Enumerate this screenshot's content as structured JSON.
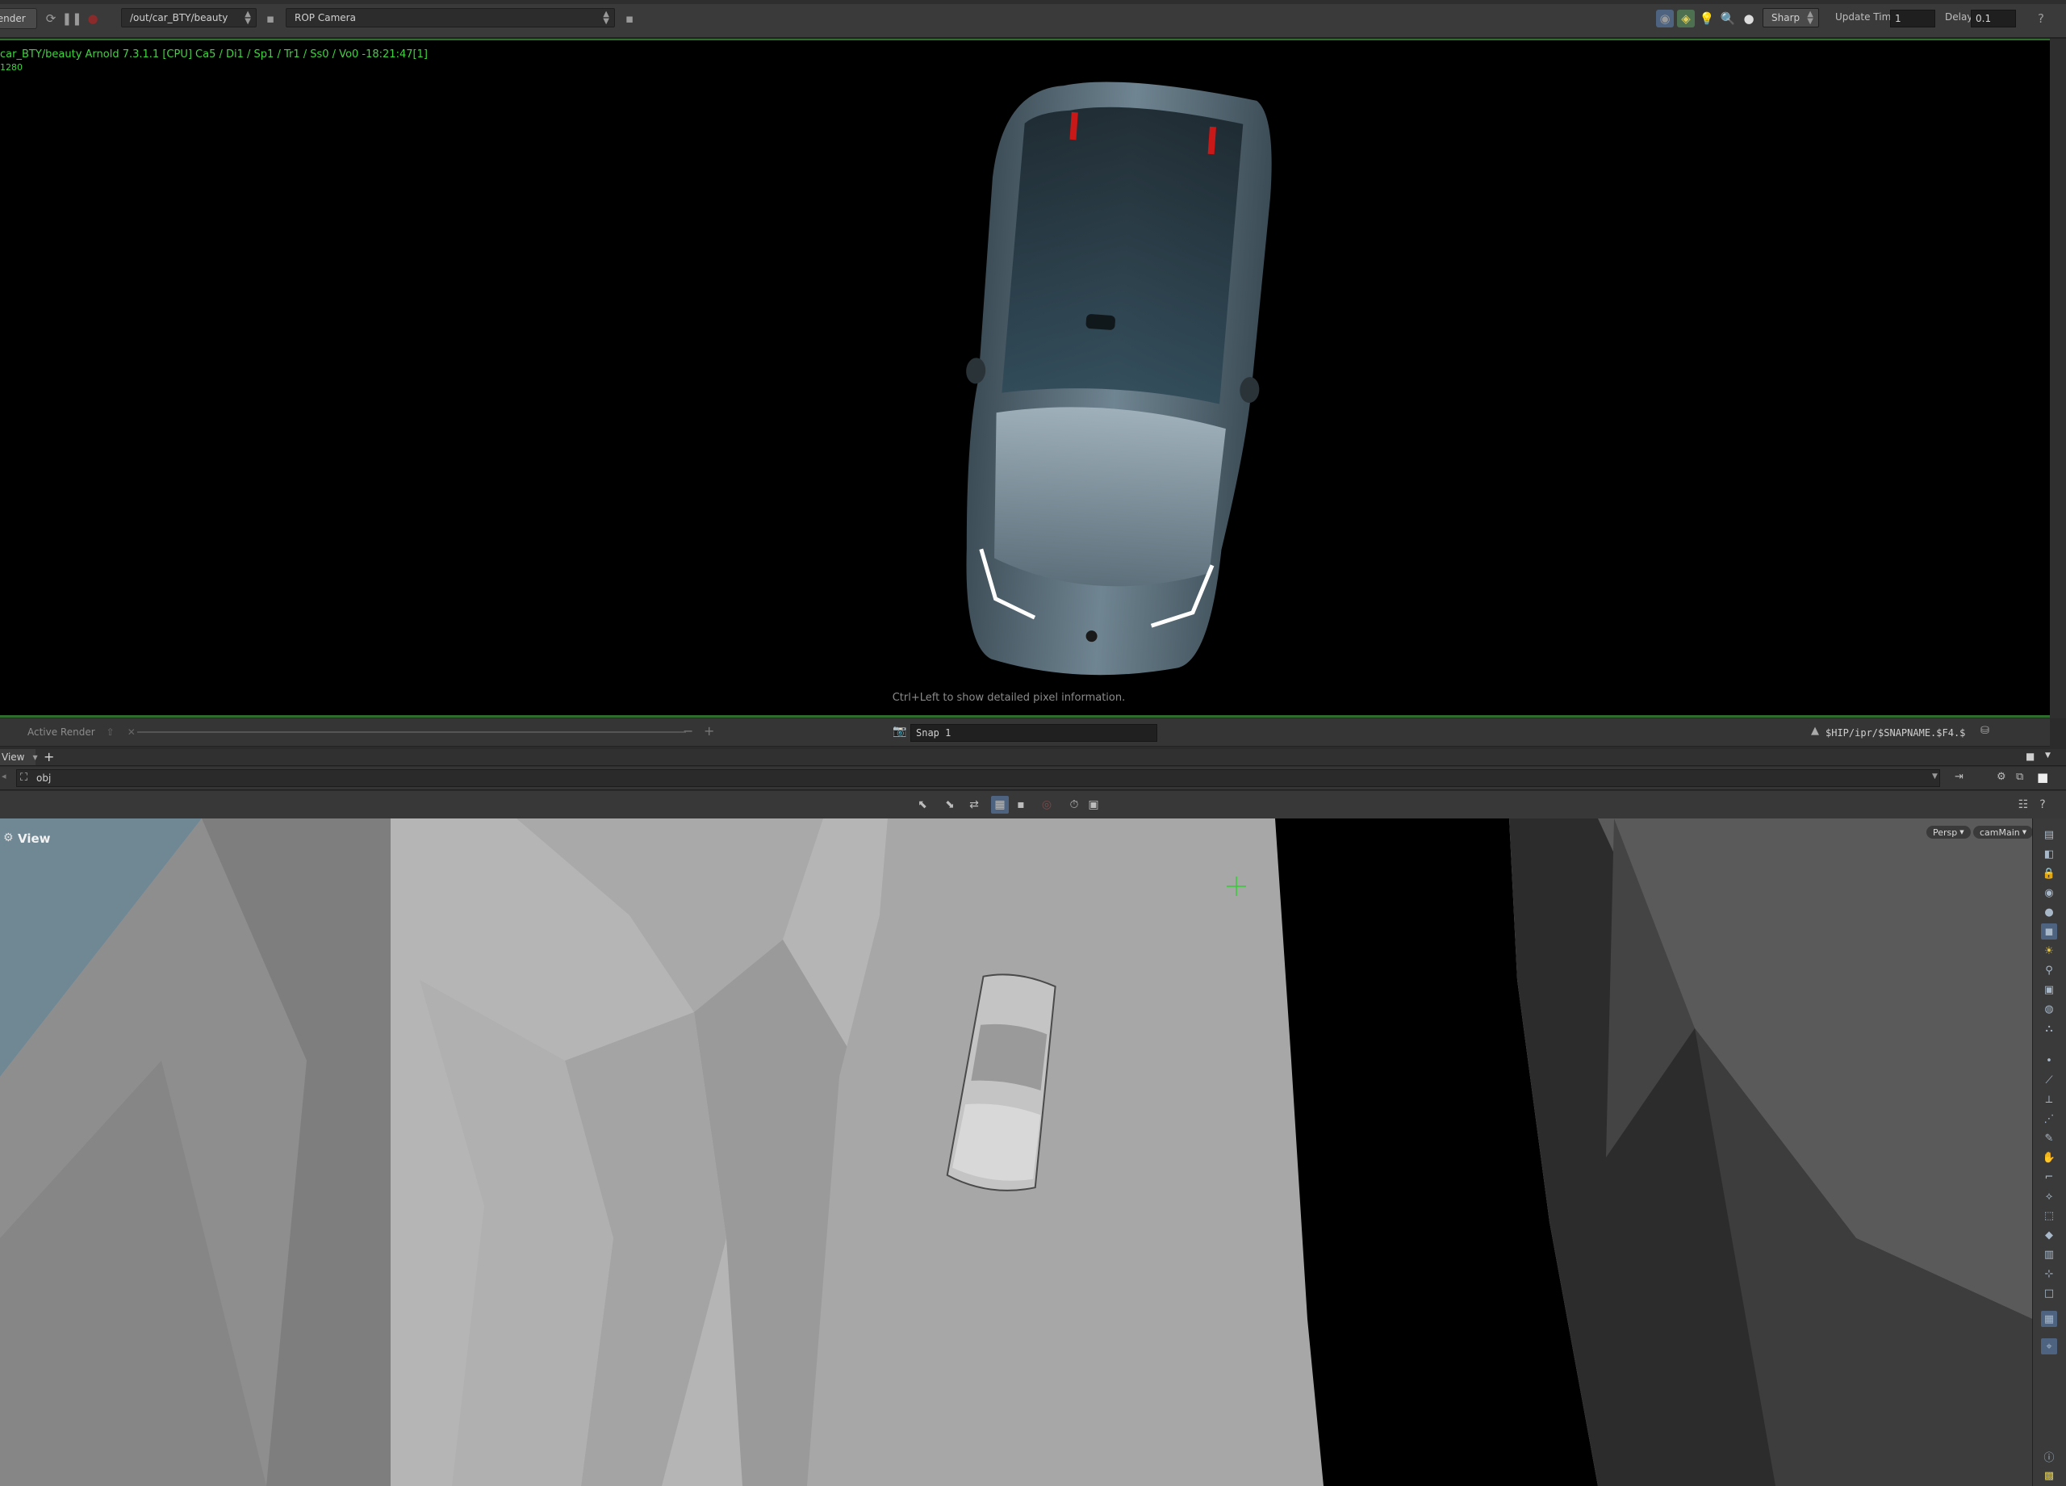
{
  "toolbar": {
    "render_button": "Render",
    "rop_path": "/out/car_BTY/beauty",
    "camera": "ROP Camera",
    "filter": "Sharp",
    "update_time_label": "Update Time",
    "update_time_value": "1",
    "delay_label": "Delay",
    "delay_value": "0.1"
  },
  "render_view": {
    "info_line": "car_BTY/beauty  Arnold 7.3.1.1 [CPU]  Ca5 / Di1 / Sp1 / Tr1 / Ss0 / Vo0 -18:21:47[1]",
    "info_line2": "1280",
    "hint": "Ctrl+Left to show detailed pixel information."
  },
  "render_status": {
    "active_tab": "Active Render",
    "snap_name": "Snap 1",
    "snap_path": "$HIP/ipr/$SNAPNAME.$F4.$"
  },
  "pane_tabs": {
    "view_tab": "View"
  },
  "path_bar": {
    "context": "obj"
  },
  "viewport": {
    "label": "View",
    "projection": "Persp",
    "camera": "camMain"
  },
  "colors": {
    "accent_green": "#2f6d2f",
    "info_text": "#3fd43f"
  }
}
